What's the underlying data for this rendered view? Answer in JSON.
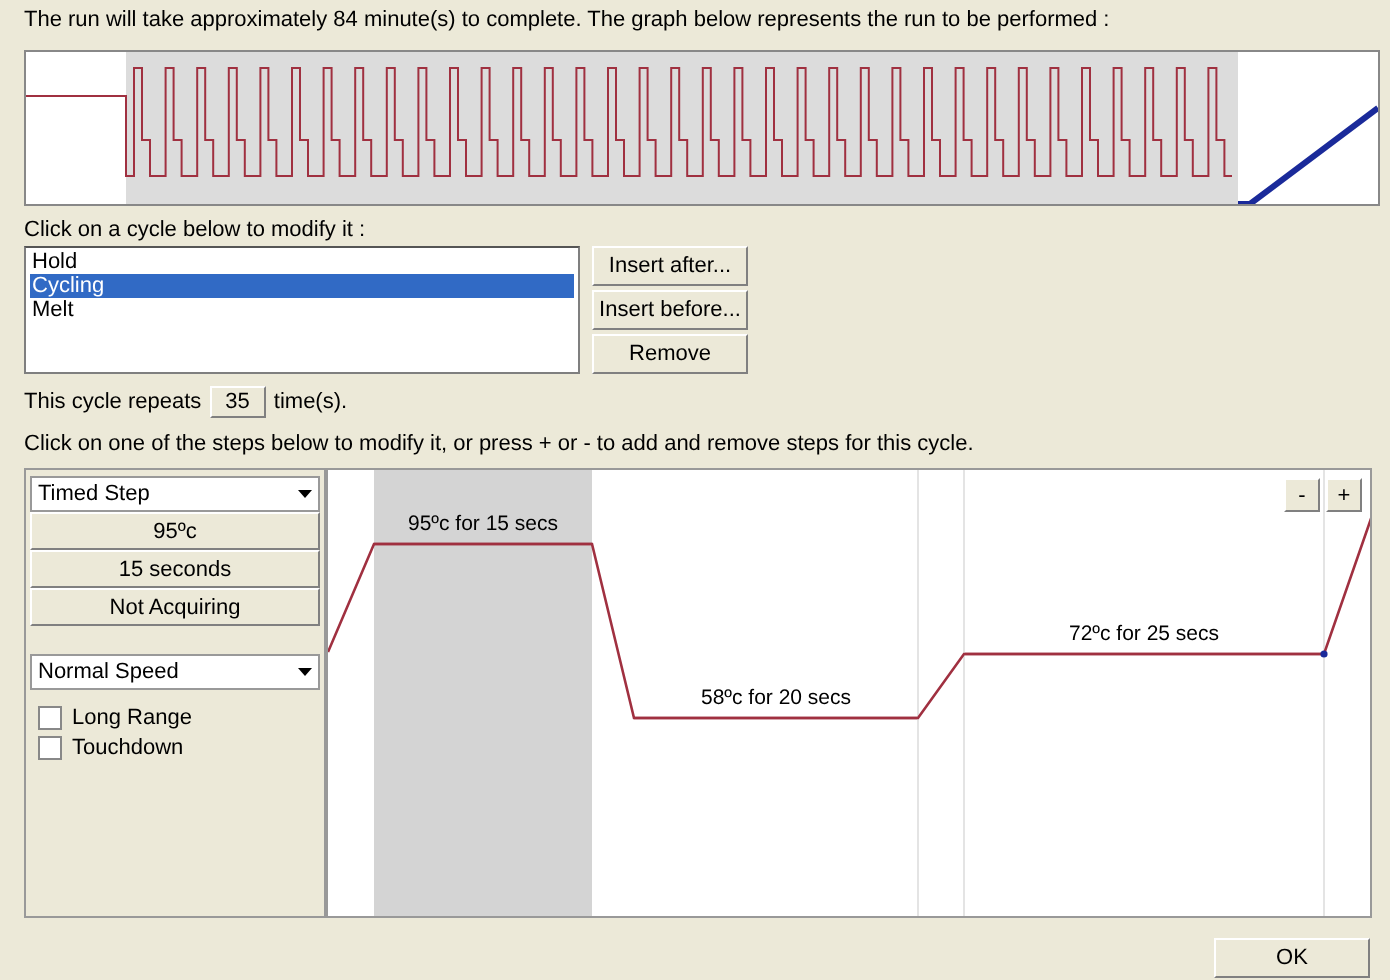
{
  "summary": "The run will take approximately 84 minute(s) to complete. The graph below represents the run to be performed :",
  "cycles_label": "Click on a cycle below to modify it :",
  "cycles": [
    {
      "label": "Hold",
      "selected": false
    },
    {
      "label": "Cycling",
      "selected": true
    },
    {
      "label": "Melt",
      "selected": false
    }
  ],
  "cycle_buttons": [
    "Insert after...",
    "Insert before...",
    "Remove"
  ],
  "repeats": {
    "prefix": "This cycle repeats",
    "value": "35",
    "suffix": "time(s)."
  },
  "steps_hint": "Click on one of the steps below to modify it, or press + or - to add and remove steps for this cycle.",
  "step_settings": {
    "type": "Timed Step",
    "temperature": "95ºc",
    "duration": "15 seconds",
    "acquisition": "Not Acquiring",
    "speed": "Normal Speed",
    "options": [
      {
        "label": "Long Range",
        "checked": false
      },
      {
        "label": "Touchdown",
        "checked": false
      }
    ]
  },
  "steps": [
    {
      "label": "95ºc for 15 secs",
      "selected": true
    },
    {
      "label": "58ºc for 20 secs",
      "selected": false
    },
    {
      "label": "72ºc for 25 secs",
      "selected": false
    }
  ],
  "step_buttons": [
    "-",
    "+"
  ],
  "ok_button": "OK"
}
